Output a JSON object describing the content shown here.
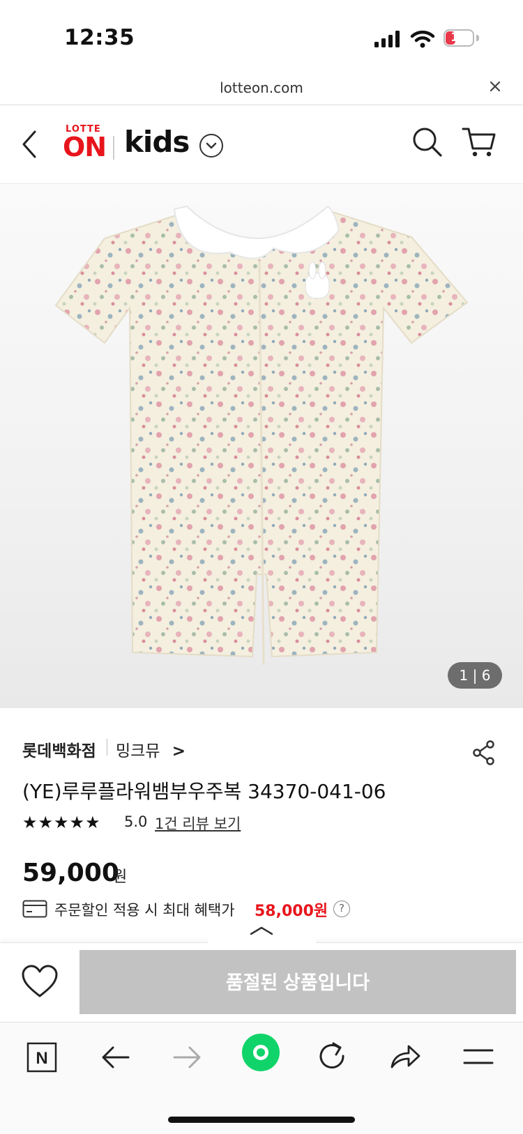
{
  "status_bar": {
    "time": "12:35",
    "battery_level": "15"
  },
  "browser": {
    "url": "lotteon.com"
  },
  "header": {
    "logo_lotte": "LOTTE",
    "logo_on": "ON",
    "logo_kids": "kids"
  },
  "gallery": {
    "counter": "1 | 6"
  },
  "product": {
    "store": "롯데백화점",
    "brand": "밍크뮤",
    "brand_chevron": ">",
    "title": "(YE)루루플라워뱀부우주복 34370-041-06",
    "stars": "★★★★★",
    "rating": "5.0",
    "review_link": "1건 리뷰 보기",
    "price": "59,000",
    "price_unit": "원",
    "benefit_label": "주문할인 적용 시 최대 혜택가",
    "benefit_price": "58,000원",
    "help": "?"
  },
  "buy_bar": {
    "sold_out_label": "품절된 상품입니다"
  },
  "colors": {
    "brand_red": "#e8141c",
    "disabled_gray": "#c2c2c2"
  }
}
